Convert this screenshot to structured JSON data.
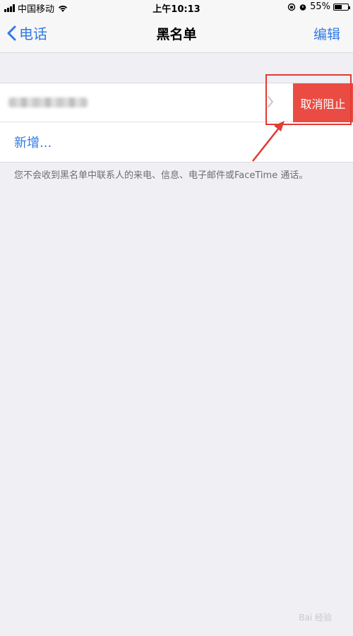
{
  "status_bar": {
    "carrier": "中国移动",
    "time": "上午10:13",
    "battery_percent": "55%",
    "battery_level": 0.55
  },
  "nav": {
    "back_label": "电话",
    "title": "黑名单",
    "edit_label": "编辑"
  },
  "blocked_list": {
    "unblock_label": "取消阻止",
    "add_label": "新增..."
  },
  "footnote": "您不会收到黑名单中联系人的来电、信息、电子邮件或FaceTime 通话。",
  "watermark": "Bai 经验",
  "colors": {
    "accent": "#2f7ae5",
    "destructive": "#ea4c43",
    "annotation": "#e23b34"
  }
}
